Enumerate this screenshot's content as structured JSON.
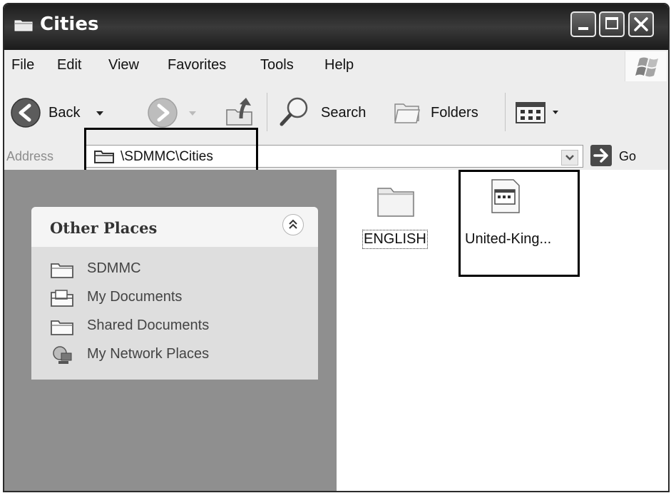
{
  "window": {
    "title": "Cities"
  },
  "menu": {
    "items": [
      "File",
      "Edit",
      "View",
      "Favorites",
      "Tools",
      "Help"
    ]
  },
  "toolbar": {
    "back_label": "Back",
    "search_label": "Search",
    "folders_label": "Folders"
  },
  "address": {
    "label": "Address",
    "path": "\\SDMMC\\Cities",
    "go_label": "Go"
  },
  "other_places": {
    "title": "Other Places",
    "items": [
      {
        "label": "SDMMC",
        "icon": "folder-icon"
      },
      {
        "label": "My Documents",
        "icon": "my-documents-icon"
      },
      {
        "label": "Shared Documents",
        "icon": "shared-folder-icon"
      },
      {
        "label": "My Network Places",
        "icon": "network-places-icon"
      }
    ]
  },
  "files": [
    {
      "name": "ENGLISH",
      "icon": "folder-icon",
      "selected": true
    },
    {
      "name": "United-King...",
      "icon": "application-file-icon",
      "selected": false
    }
  ],
  "colors": {
    "titlebar": "#2a2a2a",
    "panel": "#8f8f8f",
    "highlight_box": "#000000"
  }
}
